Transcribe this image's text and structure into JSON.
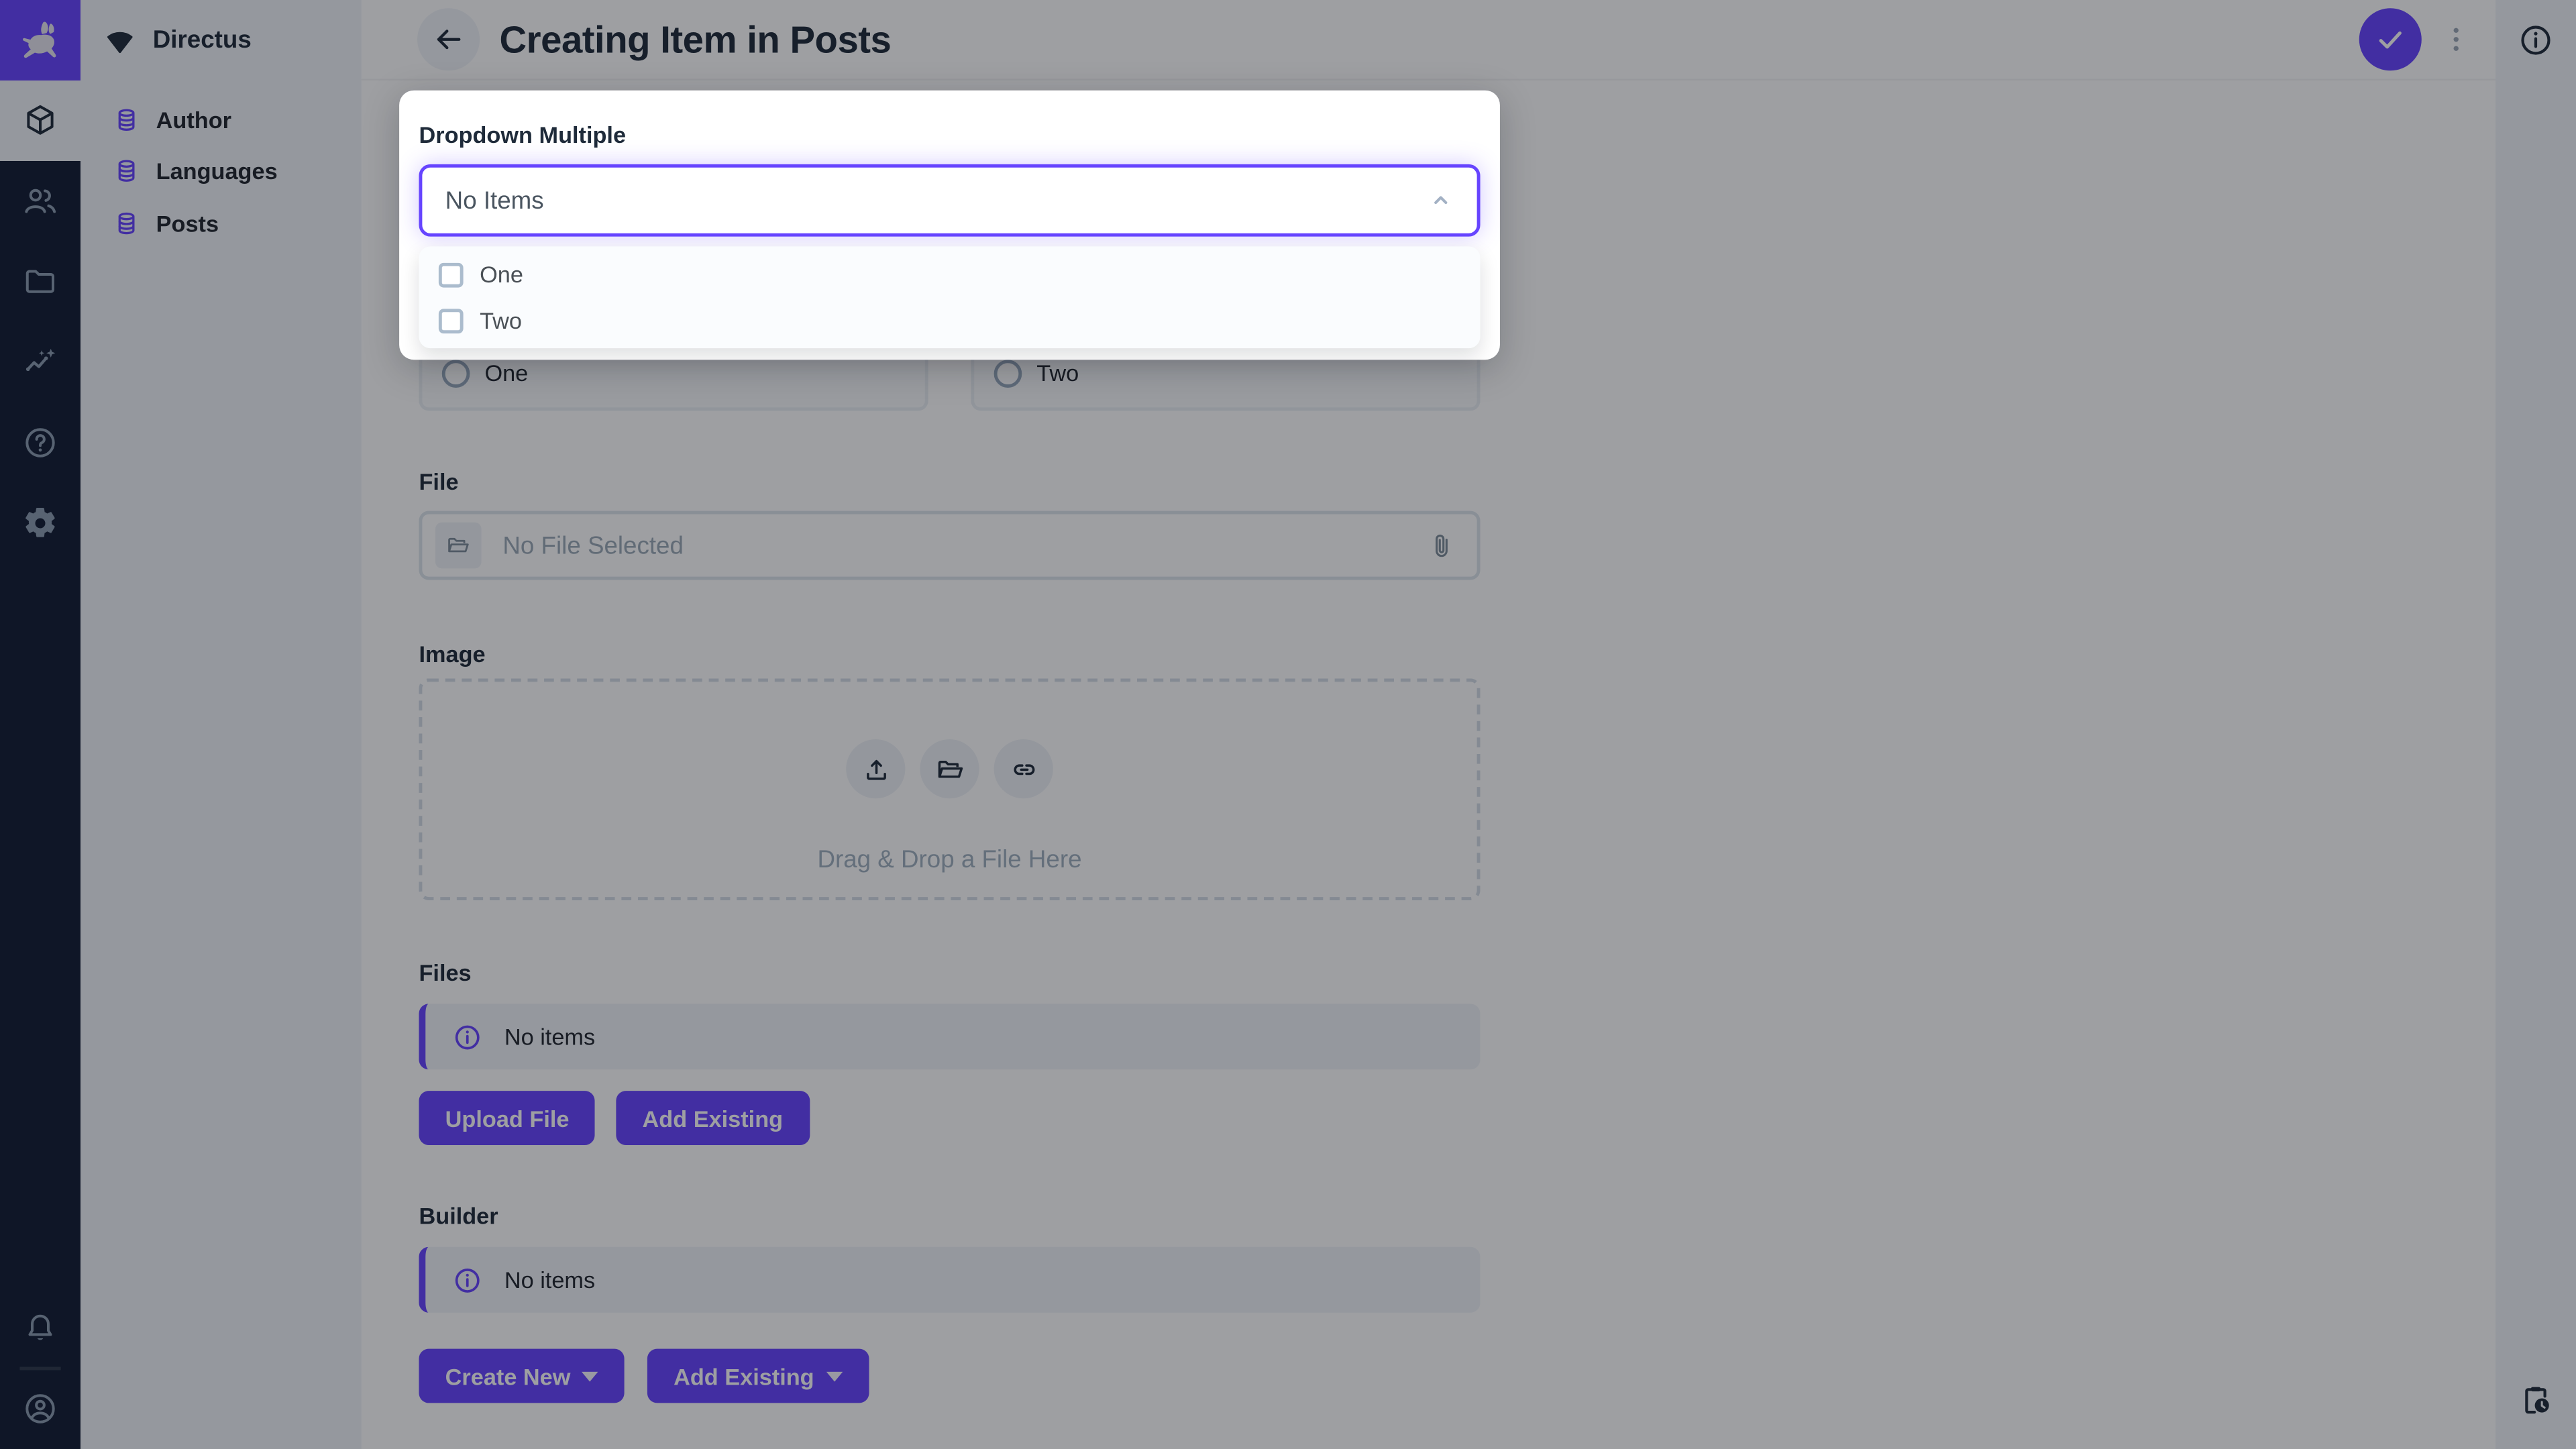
{
  "theme": {
    "accent": "#6644FF",
    "module_bar_bg": "#111C32",
    "sidebar_bg": "#F0F4F9",
    "content_bg": "#FFFFFF",
    "text_dark": "#1F2B3A",
    "text_muted": "#9AA8B6"
  },
  "module_bar": {
    "modules": [
      {
        "name": "content-module",
        "icon": "box-icon",
        "active": true
      },
      {
        "name": "users-module",
        "icon": "people-icon",
        "active": false
      },
      {
        "name": "files-module",
        "icon": "folder-icon",
        "active": false
      },
      {
        "name": "insights-module",
        "icon": "insights-icon",
        "active": false
      },
      {
        "name": "help-module",
        "icon": "help-icon",
        "active": false
      },
      {
        "name": "settings-module",
        "icon": "gear-icon",
        "active": false
      }
    ],
    "bottom": [
      {
        "name": "notifications",
        "icon": "bell-icon"
      },
      {
        "name": "profile",
        "icon": "avatar-icon"
      }
    ]
  },
  "nav": {
    "project_name": "Directus",
    "items": [
      {
        "label": "Author",
        "active": false
      },
      {
        "label": "Languages",
        "active": false
      },
      {
        "label": "Posts",
        "active": true
      }
    ]
  },
  "header": {
    "title": "Creating Item in Posts"
  },
  "dropdown_panel": {
    "label": "Dropdown Multiple",
    "value": "No Items",
    "options": [
      {
        "label": "One",
        "checked": false
      },
      {
        "label": "Two",
        "checked": false
      }
    ]
  },
  "form": {
    "radio_options": [
      {
        "label": "One",
        "selected": false
      },
      {
        "label": "Two",
        "selected": false
      }
    ],
    "file": {
      "label": "File",
      "placeholder": "No File Selected"
    },
    "image": {
      "label": "Image",
      "dropzone_text": "Drag & Drop a File Here"
    },
    "files": {
      "label": "Files",
      "notice": "No items",
      "upload_button": "Upload File",
      "add_button": "Add Existing"
    },
    "builder": {
      "label": "Builder",
      "notice": "No items",
      "create_button": "Create New",
      "add_button": "Add Existing"
    }
  }
}
